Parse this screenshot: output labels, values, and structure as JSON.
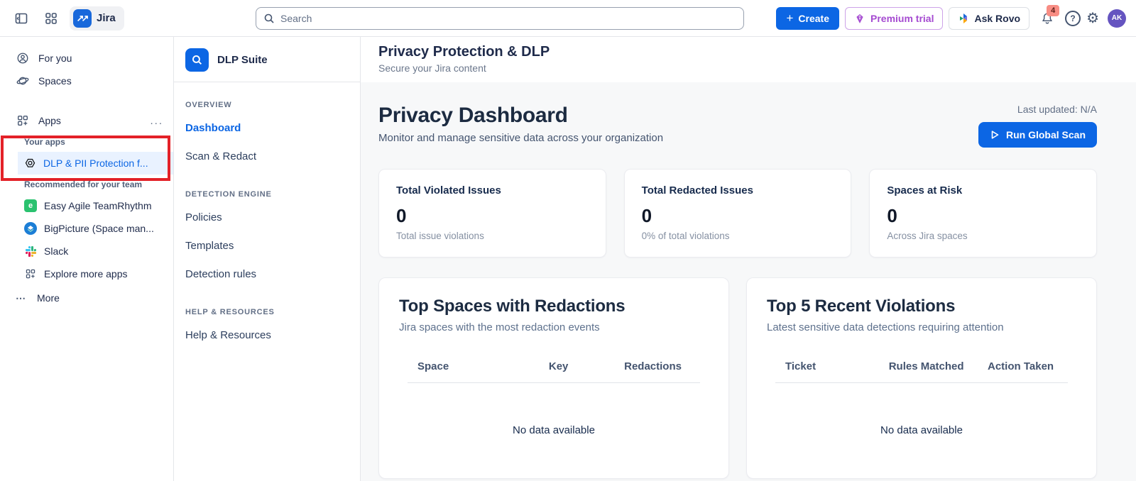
{
  "topbar": {
    "app_name": "Jira",
    "search_placeholder": "Search",
    "create_label": "Create",
    "premium_trial_label": "Premium trial",
    "ask_rovo_label": "Ask Rovo",
    "notification_count": "4",
    "avatar_initials": "AK"
  },
  "left_sidebar": {
    "for_you_label": "For you",
    "spaces_label": "Spaces",
    "apps_label": "Apps",
    "apps_more_icon": "...",
    "your_apps_label": "Your apps",
    "selected_app": "DLP & PII Protection f...",
    "recommended_label": "Recommended for your team",
    "recommended_apps": [
      "Easy Agile TeamRhythm",
      "BigPicture (Space man...",
      "Slack"
    ],
    "explore_label": "Explore more apps",
    "more_label": "More"
  },
  "app_sidebar": {
    "title": "DLP Suite",
    "sections": [
      {
        "heading": "OVERVIEW",
        "items": [
          {
            "label": "Dashboard"
          },
          {
            "label": "Scan & Redact"
          }
        ]
      },
      {
        "heading": "DETECTION ENGINE",
        "items": [
          {
            "label": "Policies"
          },
          {
            "label": "Templates"
          },
          {
            "label": "Detection rules"
          }
        ]
      },
      {
        "heading": "HELP & RESOURCES",
        "items": [
          {
            "label": "Help & Resources"
          }
        ]
      }
    ]
  },
  "page_header": {
    "title": "Privacy Protection & DLP",
    "subtitle": "Secure your Jira content"
  },
  "dashboard": {
    "title": "Privacy Dashboard",
    "subtitle": "Monitor and manage sensitive data across your organization",
    "last_updated": "Last updated: N/A",
    "run_scan_label": "Run Global Scan",
    "stats": [
      {
        "title": "Total Violated Issues",
        "value": "0",
        "caption": "Total issue violations"
      },
      {
        "title": "Total Redacted Issues",
        "value": "0",
        "caption": "0% of total violations"
      },
      {
        "title": "Spaces at Risk",
        "value": "0",
        "caption": "Across Jira spaces"
      }
    ],
    "tables": [
      {
        "title": "Top Spaces with Redactions",
        "subtitle": "Jira spaces with the most redaction events",
        "columns": [
          "Space",
          "Key",
          "Redactions"
        ],
        "empty": "No data available"
      },
      {
        "title": "Top 5 Recent Violations",
        "subtitle": "Latest sensitive data detections requiring attention",
        "columns": [
          "Ticket",
          "Rules Matched",
          "Action Taken"
        ],
        "empty": "No data available"
      }
    ]
  },
  "colors": {
    "accent_blue": "#0C66E4",
    "jira_logo_blue": "#1868DB",
    "selected_item_bg": "#E9F2FF",
    "annotation_red": "#E32128",
    "premium_purple": "#A54AD1",
    "notification_badge_bg": "#F88D84",
    "notification_badge_text": "#5D1F1A",
    "avatar_purple": "#6554C0",
    "content_bg": "#F7F8F9"
  }
}
